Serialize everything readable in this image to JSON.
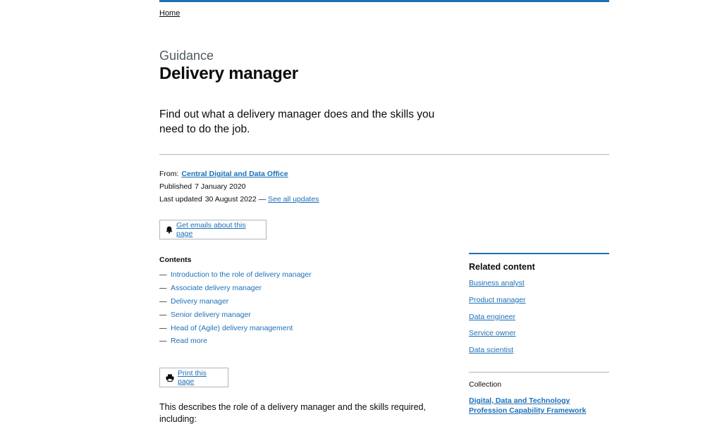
{
  "breadcrumb": {
    "home": "Home"
  },
  "header": {
    "caption": "Guidance",
    "title": "Delivery manager",
    "lead": "Find out what a delivery manager does and the skills you need to do the job."
  },
  "metadata": {
    "from_label": "From:",
    "from_org": "Central Digital and Data Office",
    "published_label": "Published",
    "published_date": "7 January 2020",
    "updated_label": "Last updated",
    "updated_date": "30 August 2022 —",
    "see_updates": "See all updates"
  },
  "actions": {
    "email_signup": "Get emails about this page",
    "print": "Print this page",
    "email_icon": "bell-icon",
    "print_icon": "printer-icon"
  },
  "contents": {
    "heading": "Contents",
    "dash": "—",
    "items": [
      "Introduction to the role of delivery manager",
      "Associate delivery manager",
      "Delivery manager",
      "Senior delivery manager",
      "Head of (Agile) delivery management",
      "Read more"
    ]
  },
  "body": {
    "intro": "This describes the role of a delivery manager and the skills required, including:"
  },
  "sidebar": {
    "related_heading": "Related content",
    "related": [
      "Business analyst",
      "Product manager",
      "Data engineer",
      "Service owner",
      "Data scientist"
    ],
    "collection_heading": "Collection",
    "collection_link": "Digital, Data and Technology Profession Capability Framework"
  },
  "colors": {
    "link": "#1d70b8",
    "text": "#0b0c0c",
    "secondary_text": "#505a5f",
    "border": "#b1b4b6"
  }
}
